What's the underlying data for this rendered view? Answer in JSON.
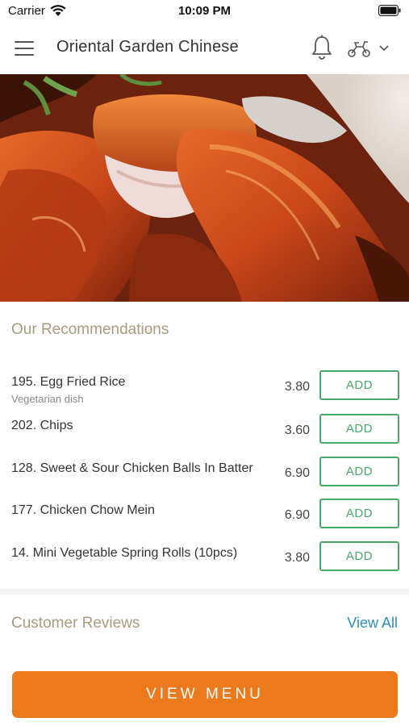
{
  "status_bar": {
    "carrier": "Carrier",
    "time": "10:09 PM"
  },
  "header": {
    "title": "Oriental Garden Chinese",
    "icons": [
      "menu-icon",
      "bell-icon",
      "scooter-icon",
      "chevron-down-icon"
    ]
  },
  "hero": {
    "image": "roast duck dish",
    "colors": {
      "dark": "#5a1e0c",
      "glaze": "#c9471a",
      "meat": "#efdcd8",
      "herb": "#5f8f3e"
    }
  },
  "recommendations": {
    "title": "Our Recommendations",
    "add_label": "ADD",
    "items": [
      {
        "name": "195. Egg Fried Rice",
        "note": "Vegetarian dish",
        "price": "3.80"
      },
      {
        "name": "202. Chips",
        "note": "",
        "price": "3.60"
      },
      {
        "name": "128. Sweet & Sour Chicken Balls In Batter",
        "note": "",
        "price": "6.90"
      },
      {
        "name": "177. Chicken Chow Mein",
        "note": "",
        "price": "6.90"
      },
      {
        "name": "14. Mini Vegetable Spring Rolls (10pcs)",
        "note": "",
        "price": "3.80"
      }
    ]
  },
  "reviews": {
    "title": "Customer Reviews",
    "view_all": "View All"
  },
  "cta": {
    "view_menu": "VIEW MENU"
  },
  "colors": {
    "accent_orange": "#ec7a1c",
    "add_green": "#4aa76a",
    "link_blue": "#2a8fbf",
    "section_title": "#a99b80"
  }
}
